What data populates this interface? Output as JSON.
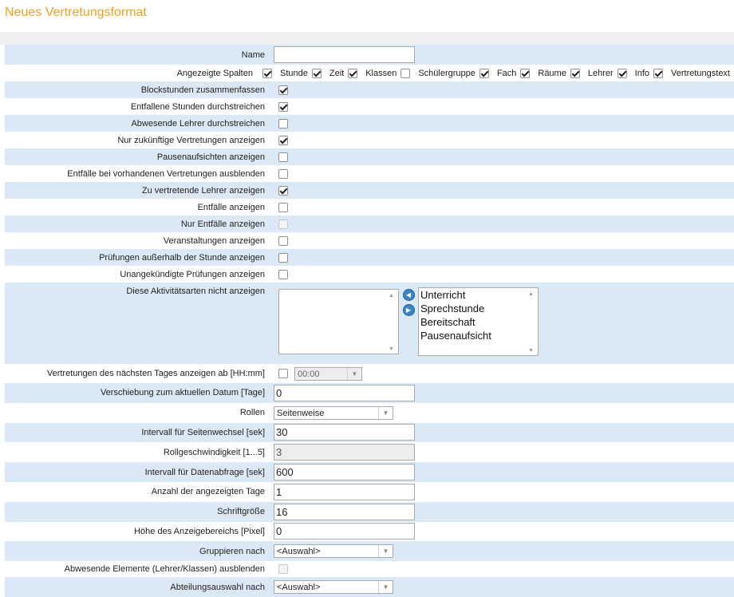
{
  "page": {
    "title": "Neues Vertretungsformat"
  },
  "fields": {
    "name": {
      "label": "Name",
      "value": ""
    },
    "columns": {
      "label": "Angezeigte Spalten",
      "items": [
        {
          "label": "Stunde",
          "checked": true
        },
        {
          "label": "Zeit",
          "checked": true
        },
        {
          "label": "Klassen",
          "checked": true
        },
        {
          "label": "Schülergruppe",
          "checked": false
        },
        {
          "label": "Fach",
          "checked": true
        },
        {
          "label": "Räume",
          "checked": true
        },
        {
          "label": "Lehrer",
          "checked": true
        },
        {
          "label": "Info",
          "checked": true
        },
        {
          "label": "Vertretungstext",
          "checked": true
        }
      ]
    },
    "checkbox_rows": [
      {
        "label": "Blockstunden zusammenfassen",
        "checked": true,
        "disabled": false
      },
      {
        "label": "Entfallene Stunden durchstreichen",
        "checked": true,
        "disabled": false
      },
      {
        "label": "Abwesende Lehrer durchstreichen",
        "checked": false,
        "disabled": false
      },
      {
        "label": "Nur zukünftige Vertretungen anzeigen",
        "checked": true,
        "disabled": false
      },
      {
        "label": "Pausenaufsichten anzeigen",
        "checked": false,
        "disabled": false
      },
      {
        "label": "Entfälle bei vorhandenen Vertretungen ausblenden",
        "checked": false,
        "disabled": false
      },
      {
        "label": "Zu vertretende Lehrer anzeigen",
        "checked": true,
        "disabled": false
      },
      {
        "label": "Entfälle anzeigen",
        "checked": false,
        "disabled": false
      },
      {
        "label": "Nur Entfälle anzeigen",
        "checked": false,
        "disabled": true
      },
      {
        "label": "Veranstaltungen anzeigen",
        "checked": false,
        "disabled": false
      },
      {
        "label": "Prüfungen außerhalb der Stunde anzeigen",
        "checked": false,
        "disabled": false
      },
      {
        "label": "Unangekündigte Prüfungen anzeigen",
        "checked": false,
        "disabled": false
      }
    ],
    "activities": {
      "label": "Diese Aktivitätsarten nicht anzeigen",
      "excluded": [],
      "available": [
        "Unterricht",
        "Sprechstunde",
        "Bereitschaft",
        "Pausenaufsicht"
      ]
    },
    "next_day": {
      "label": "Vertretungen des nächsten Tages anzeigen ab [HH:mm]",
      "checked": false,
      "time": "00:00"
    },
    "shift_days": {
      "label": "Verschiebung zum aktuellen Datum [Tage]",
      "value": "0"
    },
    "scroll": {
      "label": "Rollen",
      "value": "Seitenweise"
    },
    "page_interval": {
      "label": "Intervall für Seitenwechsel [sek]",
      "value": "30"
    },
    "scroll_speed": {
      "label": "Rollgeschwindigkeit [1...5]",
      "value": "3"
    },
    "data_interval": {
      "label": "Intervall für Datenabfrage [sek]",
      "value": "600"
    },
    "days_shown": {
      "label": "Anzahl der angezeigten Tage",
      "value": "1"
    },
    "font_size": {
      "label": "Schriftgröße",
      "value": "16"
    },
    "display_height": {
      "label": "Höhe des Anzeigebereichs [Pixel]",
      "value": "0"
    },
    "group_by": {
      "label": "Gruppieren nach",
      "value": "<Auswahl>"
    },
    "hide_absent": {
      "label": "Abwesende Elemente (Lehrer/Klassen) ausblenden",
      "checked": false,
      "disabled": true
    },
    "department": {
      "label": "Abteilungsauswahl nach",
      "value": "<Auswahl>"
    }
  },
  "icons": {
    "move_left": "arrow-left-circle-icon",
    "move_right": "arrow-right-circle-icon",
    "dropdown": "chevron-down-icon",
    "scroll_up": "scroll-up-icon",
    "scroll_down": "scroll-down-icon"
  },
  "colors": {
    "title": "#f0a020",
    "row_alt": "#dbe9f7",
    "button": "#3a86c7"
  }
}
